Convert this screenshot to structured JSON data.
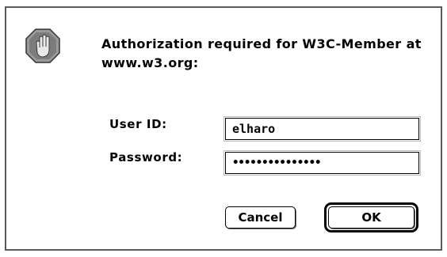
{
  "dialog": {
    "message": "Authorization required for W3C-Member at www.w3.org:",
    "icon": "stop-hand-icon",
    "fields": {
      "user_label": "User ID:",
      "user_value": "elharo",
      "password_label": "Password:",
      "password_value": "•••••••••••••••"
    },
    "buttons": {
      "cancel_label": "Cancel",
      "ok_label": "OK"
    }
  }
}
